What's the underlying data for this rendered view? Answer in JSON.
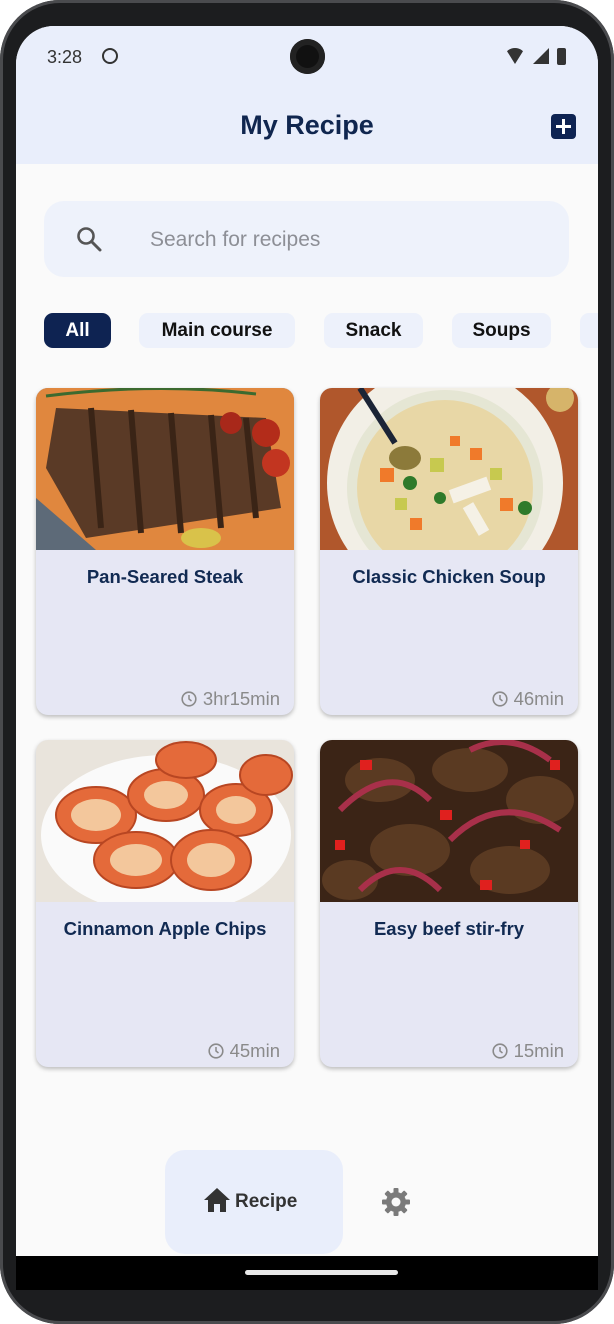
{
  "status": {
    "time": "3:28"
  },
  "header": {
    "title": "My Recipe"
  },
  "search": {
    "placeholder": "Search for recipes"
  },
  "categories": [
    {
      "label": "All",
      "active": true
    },
    {
      "label": "Main course",
      "active": false
    },
    {
      "label": "Snack",
      "active": false
    },
    {
      "label": "Soups",
      "active": false
    }
  ],
  "recipes": [
    {
      "title": "Pan-Seared Steak",
      "time": "3hr15min",
      "image": "steak-photo"
    },
    {
      "title": "Classic Chicken Soup",
      "time": "46min",
      "image": "chicken-soup-photo"
    },
    {
      "title": "Cinnamon Apple Chips",
      "time": "45min",
      "image": "apple-chips-photo"
    },
    {
      "title": "Easy beef stir-fry",
      "time": "15min",
      "image": "beef-stir-fry-photo"
    }
  ],
  "nav": {
    "recipe_label": "Recipe",
    "recipe_icon": "home-icon",
    "settings_icon": "gear-icon"
  },
  "colors": {
    "primary": "#0e2352",
    "surface": "#e9eefb",
    "card": "#e6e7f4"
  }
}
